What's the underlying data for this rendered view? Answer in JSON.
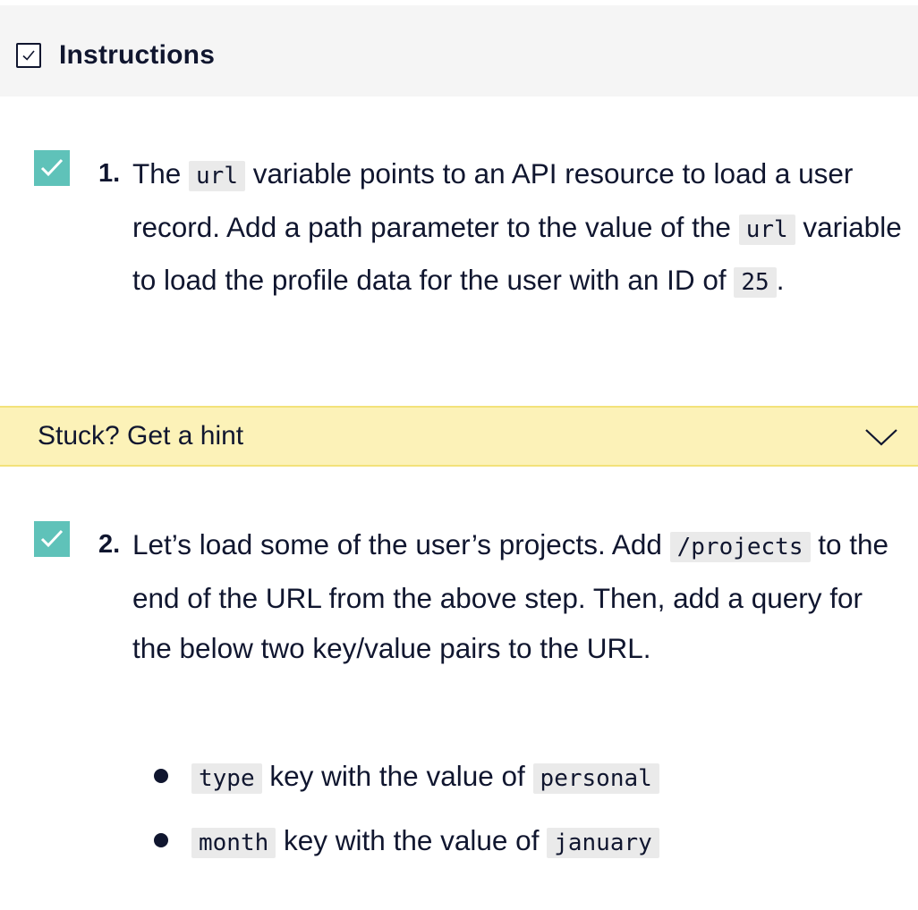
{
  "header": {
    "title": "Instructions",
    "icon": "checkbox-icon"
  },
  "tasks": [
    {
      "number": "1.",
      "checked": true,
      "parts": {
        "t1": "The ",
        "c1": "url",
        "t2": " variable points to an API resource to load a user record. Add a path parameter to the value of the ",
        "c2": "url",
        "t3": " variable to load the profile data for the user with an ID of ",
        "c3": "25",
        "t4": "."
      }
    },
    {
      "number": "2.",
      "checked": true,
      "parts": {
        "t1": "Let’s load some of the user’s projects. Add ",
        "c1": "/projects",
        "t2": " to the end of the URL from the above step. Then, add a query for the below two key/value pairs to the URL."
      },
      "bullets": [
        {
          "code1": "type",
          "text": " key with the value of ",
          "code2": "personal"
        },
        {
          "code1": "month",
          "text": " key with the value of ",
          "code2": "january"
        }
      ]
    }
  ],
  "hint": {
    "label": "Stuck? Get a hint",
    "icon": "chevron-down-icon"
  },
  "colors": {
    "check_green": "#5fc2b9",
    "hint_bg": "#fcf2b8",
    "text": "#10162f",
    "code_bg": "#eaeaea"
  }
}
